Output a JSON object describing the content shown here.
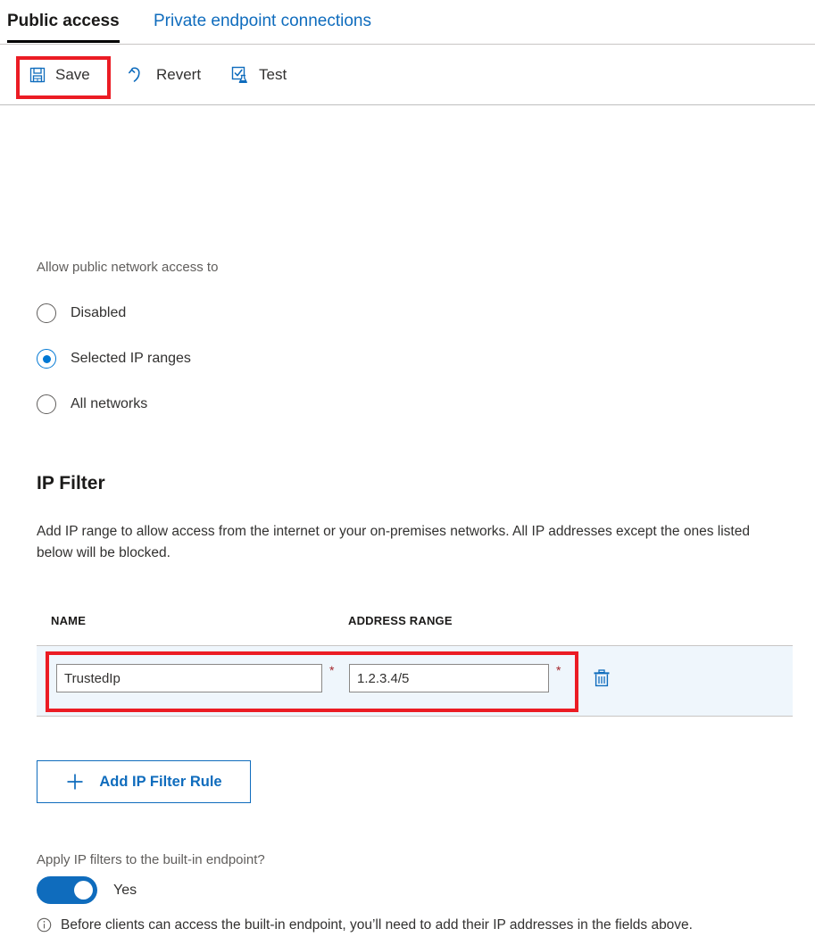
{
  "tabs": [
    {
      "label": "Public access",
      "active": true,
      "icon": ""
    },
    {
      "label": "Private endpoint connections",
      "active": false,
      "icon": ""
    }
  ],
  "toolbar": {
    "save_label": "Save",
    "save_icon": "save-floppy-icon",
    "revert_label": "Revert",
    "revert_icon": "undo-arrow-icon",
    "test_label": "Test",
    "test_icon": "test-flask-icon"
  },
  "access": {
    "label": "Allow public network access to",
    "options": [
      {
        "label": "Disabled",
        "selected": false
      },
      {
        "label": "Selected IP ranges",
        "selected": true
      },
      {
        "label": "All networks",
        "selected": false
      }
    ]
  },
  "ip_filter": {
    "title": "IP Filter",
    "description": "Add IP range to allow access from the internet or your on-premises networks. All IP addresses except the ones listed below will be blocked.",
    "columns": [
      "NAME",
      "ADDRESS RANGE"
    ],
    "rows": [
      {
        "name": "TrustedIp",
        "name_placeholder": "",
        "address_range": "1.2.3.4/5",
        "address_placeholder": "",
        "required_marker": "*",
        "delete_icon": "trash-icon"
      }
    ],
    "add_button": {
      "label": "Add IP Filter Rule",
      "icon": "plus-icon"
    }
  },
  "builtin_endpoint": {
    "label": "Apply IP filters to the built-in endpoint?",
    "toggle_state": "Yes",
    "note_icon": "info-circle-icon",
    "note": "Before clients can access the built-in endpoint, you’ll need to add their IP addresses in the fields above."
  },
  "colors": {
    "accent": "#0f6cbd",
    "toggle_on": "#0f6cbd",
    "highlight": "#eb1c24",
    "row_background": "#eff6fc",
    "required": "#a4262c",
    "active_tab_underline": "#000000"
  }
}
